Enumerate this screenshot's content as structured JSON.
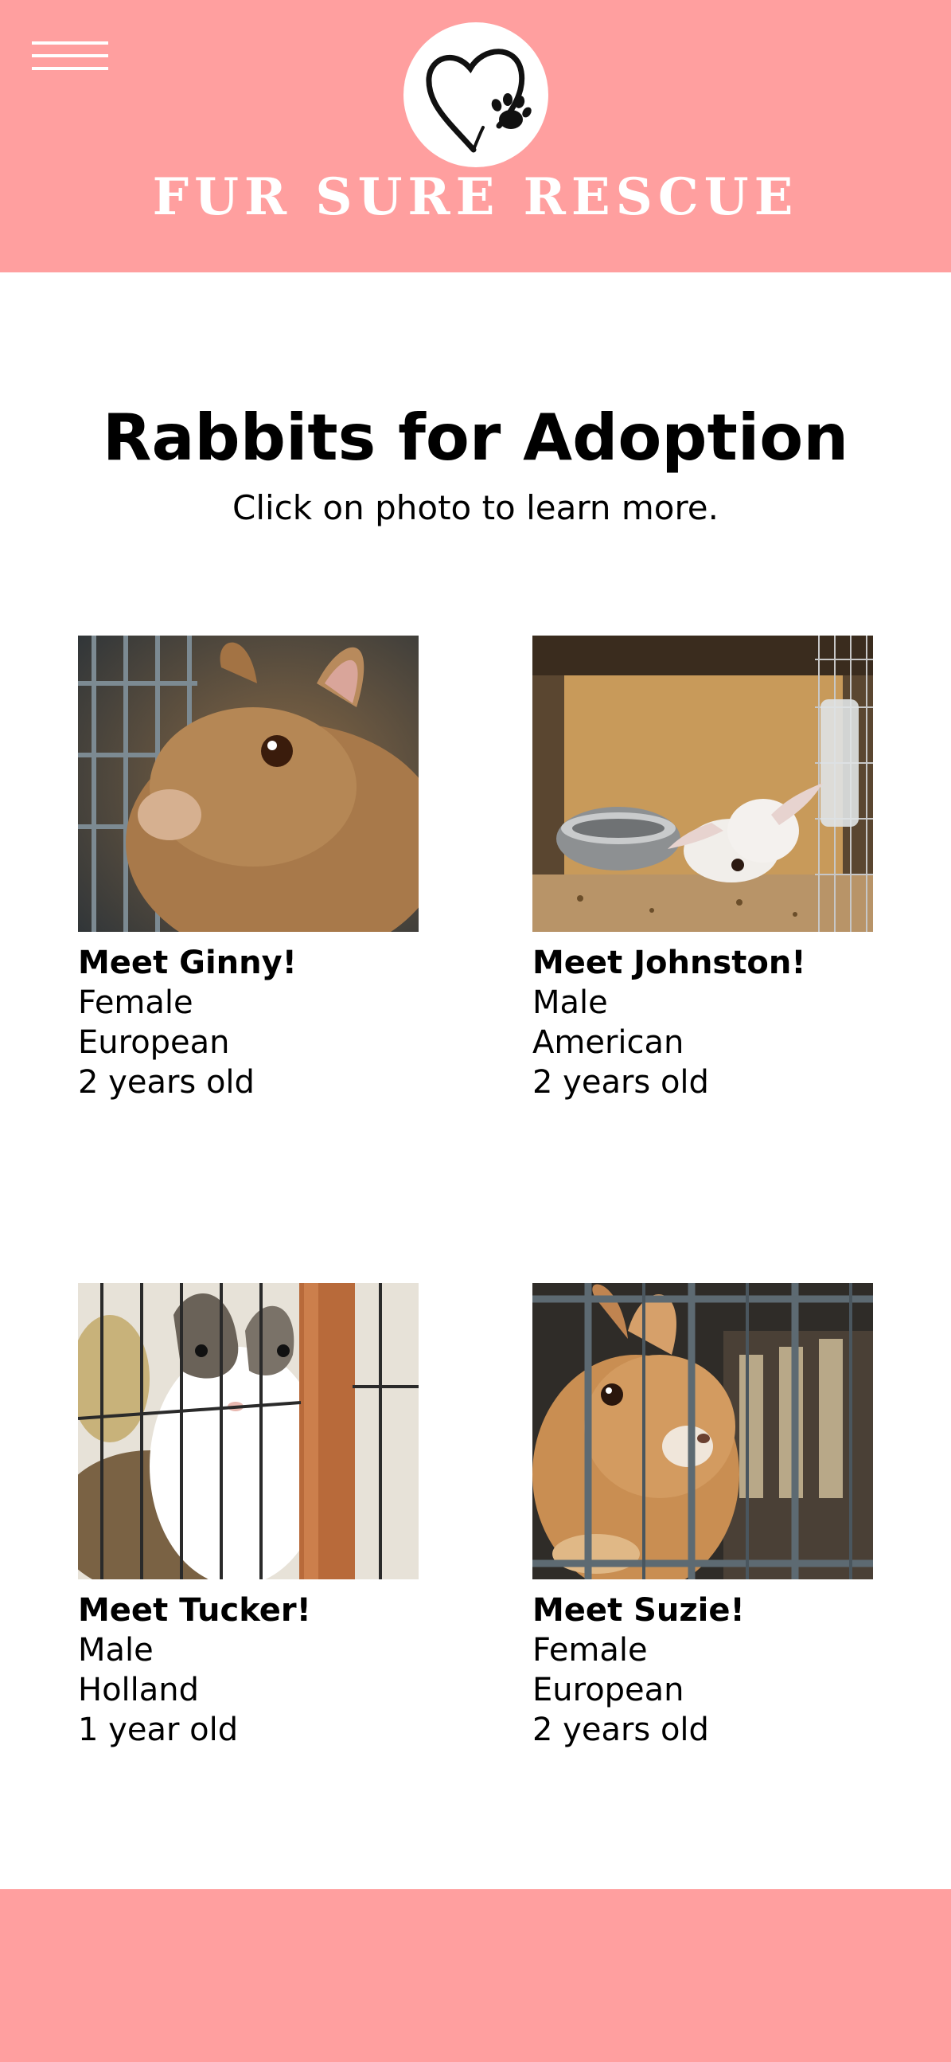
{
  "header": {
    "brand": "Fur Sure Rescue",
    "background_color": "#ff9f9f",
    "menu_icon": "hamburger-menu-icon",
    "logo_icon": "heart-paw-icon"
  },
  "main": {
    "title": "Rabbits for Adoption",
    "subtitle": "Click on photo to learn more."
  },
  "pets": [
    {
      "name": "Meet Ginny!",
      "sex": "Female",
      "breed": "European",
      "age": "2 years old",
      "photo": "brown rabbit in cage"
    },
    {
      "name": "Meet Johnston!",
      "sex": "Male",
      "breed": "American",
      "age": "2 years old",
      "photo": "white rabbit beside steel bowl"
    },
    {
      "name": "Meet Tucker!",
      "sex": "Male",
      "breed": "Holland",
      "age": "1 year old",
      "photo": "white and brown rabbit behind bars"
    },
    {
      "name": "Meet Suzie!",
      "sex": "Female",
      "breed": "European",
      "age": "2 years old",
      "photo": "ginger rabbit behind bars"
    }
  ]
}
